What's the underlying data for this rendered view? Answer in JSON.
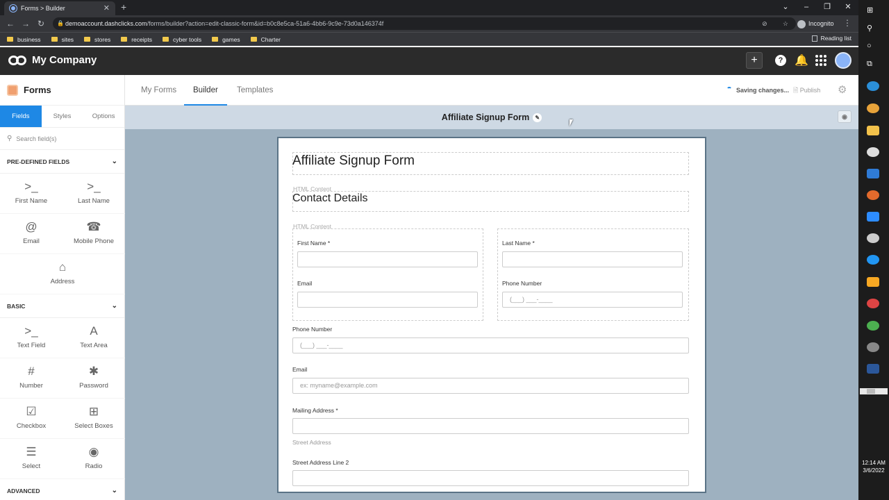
{
  "browser": {
    "tab_title": "Forms > Builder",
    "url_domain": "demoaccount.dashclicks.com",
    "url_path": "/forms/builder?action=edit-classic-form&id=b0c8e5ca-51a6-4bb6-9c9e-73d0a146374f",
    "incognito_label": "Incognito",
    "bookmarks": [
      "business",
      "sites",
      "stores",
      "receipts",
      "cyber tools",
      "games",
      "Charter"
    ],
    "reading_list": "Reading list"
  },
  "app": {
    "company": "My Company"
  },
  "sidebar": {
    "title": "Forms",
    "tabs": [
      "Fields",
      "Styles",
      "Options"
    ],
    "search_placeholder": "Search field(s)",
    "predefined_label": "PRE-DEFINED FIELDS",
    "predefined": [
      {
        "label": "First Name",
        "icon": "terminal-icon"
      },
      {
        "label": "Last Name",
        "icon": "terminal-icon"
      },
      {
        "label": "Email",
        "icon": "at-icon"
      },
      {
        "label": "Mobile Phone",
        "icon": "phone-icon"
      },
      {
        "label": "Address",
        "icon": "home-icon"
      }
    ],
    "basic_label": "BASIC",
    "basic": [
      {
        "label": "Text Field",
        "icon": "terminal-icon"
      },
      {
        "label": "Text Area",
        "icon": "font-icon"
      },
      {
        "label": "Number",
        "icon": "hash-icon"
      },
      {
        "label": "Password",
        "icon": "asterisk-icon"
      },
      {
        "label": "Checkbox",
        "icon": "checkbox-icon"
      },
      {
        "label": "Select Boxes",
        "icon": "plus-square-icon"
      },
      {
        "label": "Select",
        "icon": "list-icon"
      },
      {
        "label": "Radio",
        "icon": "radio-icon"
      }
    ],
    "advanced_label": "ADVANCED"
  },
  "topnav": {
    "tabs": [
      "My Forms",
      "Builder",
      "Templates"
    ],
    "active": "Builder",
    "saving": "Saving changes...",
    "publish": "Publish"
  },
  "form": {
    "title": "Affiliate Signup Form",
    "heading": "Affiliate Signup Form",
    "html_content": "HTML Content",
    "section": "Contact Details",
    "first_name": "First Name *",
    "last_name": "Last Name *",
    "email": "Email",
    "phone_number": "Phone Number",
    "phone_placeholder": "(___) ___-____",
    "email_placeholder": "ex: myname@example.com",
    "mailing_address": "Mailing Address *",
    "street_address": "Street Address",
    "street_line2": "Street Address Line 2"
  },
  "system": {
    "time": "12:14 AM",
    "date": "3/6/2022"
  },
  "colors": {
    "accent": "#1e88e5",
    "appbar": "#2b2b2b",
    "canvas_bg": "#9eb1c0"
  }
}
